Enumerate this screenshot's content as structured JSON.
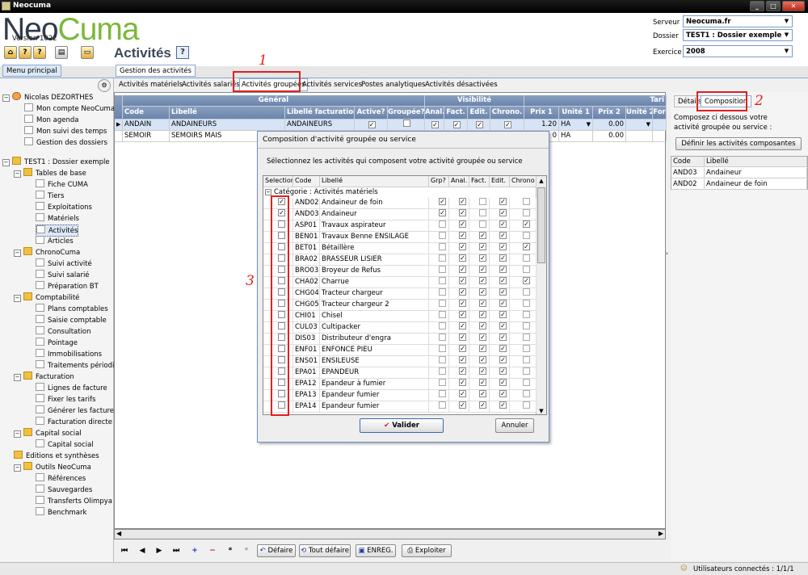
{
  "window": {
    "title": "Neocuma"
  },
  "logo": {
    "part1": "Neo",
    "part2": "Cuma",
    "version": "Version 1022"
  },
  "page": {
    "title": "Activités"
  },
  "server": {
    "server_label": "Serveur",
    "server_value": "Neocuma.fr",
    "dossier_label": "Dossier",
    "dossier_value": "TEST1 : Dossier exemple",
    "exercice_label": "Exercice",
    "exercice_value": "2008"
  },
  "tabs": {
    "menu_principal": "Menu principal",
    "gestion": "Gestion des activités"
  },
  "subtabs": [
    "Activités matériels",
    "Activités salariés",
    "Activités groupées",
    "Activités services",
    "Postes analytiques",
    "Activités désactivées"
  ],
  "tree": {
    "user": "Nicolas DEZORTHES",
    "user_items": [
      "Mon compte NeoCuma",
      "Mon agenda",
      "Mon suivi des temps",
      "Gestion des dossiers"
    ],
    "dossier": "TEST1 : Dossier exemple",
    "groups": [
      {
        "label": "Tables de base",
        "items": [
          "Fiche CUMA",
          "Tiers",
          "Exploitations",
          "Matériels",
          "Activités",
          "Articles"
        ]
      },
      {
        "label": "ChronoCuma",
        "items": [
          "Suivi activité",
          "Suivi salarié",
          "Préparation BT"
        ]
      },
      {
        "label": "Comptabilité",
        "items": [
          "Plans comptables",
          "Saisie comptable",
          "Consultation",
          "Pointage",
          "Immobilisations",
          "Traitements périodiqu"
        ]
      },
      {
        "label": "Facturation",
        "items": [
          "Lignes de facture",
          "Fixer les tarifs",
          "Générer les factures",
          "Facturation directe"
        ]
      },
      {
        "label": "Capital social",
        "items": [
          "Capital social"
        ]
      },
      {
        "label": "Editions et synthèses",
        "items": []
      },
      {
        "label": "Outils NeoCuma",
        "items": [
          "Références",
          "Sauvegardes",
          "Transferts Olimpya",
          "Benchmark"
        ]
      }
    ]
  },
  "grid": {
    "group_headers": [
      "Général",
      "Visibilité",
      "Tari"
    ],
    "columns": [
      "Code",
      "Libellé",
      "Libellé facturation",
      "Active?",
      "Groupée?",
      "Anal.",
      "Fact.",
      "Edit.",
      "Chrono.",
      "Prix 1",
      "Unité 1",
      "Prix 2",
      "Unité 2",
      "For"
    ],
    "rows": [
      {
        "code": "ANDAIN",
        "libelle": "ANDAINEURS",
        "libfact": "ANDAINEURS",
        "active": true,
        "groupee": false,
        "anal": true,
        "fact": true,
        "edit": true,
        "chrono": true,
        "prix1": "1.20",
        "unite1": "HA",
        "prix2": "0.00"
      },
      {
        "code": "SEMOIR",
        "libelle": "SEMOIRS MAIS",
        "libfact": "",
        "prix1": "0",
        "unite1": "HA",
        "prix2": "0.00"
      }
    ]
  },
  "right": {
    "tab_detail": "Détails",
    "tab_composition": "Composition",
    "text": "Composez ci dessous votre activité groupée ou service :",
    "button": "Définir les activités composantes",
    "col_code": "Code",
    "col_libelle": "Libellé",
    "rows": [
      {
        "code": "AND03",
        "libelle": "Andaineur"
      },
      {
        "code": "AND02",
        "libelle": "Andaineur de foin"
      }
    ]
  },
  "dialog": {
    "title": "Composition d'activité groupée ou service",
    "instruction": "Sélectionnez les activités qui composent votre activité groupée ou service",
    "columns": [
      "Selection",
      "Code",
      "Libellé",
      "Grp?",
      "Anal.",
      "Fact.",
      "Edit.",
      "Chrono"
    ],
    "category": "Catégorie : Activités matériels",
    "rows": [
      {
        "sel": true,
        "code": "AND02",
        "lib": "Andaineur de foin",
        "grp": true,
        "anal": true,
        "fact": false,
        "edit": true,
        "chrono": false
      },
      {
        "sel": true,
        "code": "AND03",
        "lib": "Andaineur",
        "grp": true,
        "anal": true,
        "fact": false,
        "edit": true,
        "chrono": false
      },
      {
        "sel": false,
        "code": "ASP01",
        "lib": "Travaux  aspirateur",
        "grp": false,
        "anal": true,
        "fact": false,
        "edit": true,
        "chrono": true
      },
      {
        "sel": false,
        "code": "BEN01",
        "lib": "Travaux Benne ENSILAGE",
        "grp": false,
        "anal": true,
        "fact": true,
        "edit": true,
        "chrono": false
      },
      {
        "sel": false,
        "code": "BET01",
        "lib": "Bétaillère",
        "grp": false,
        "anal": true,
        "fact": true,
        "edit": true,
        "chrono": true
      },
      {
        "sel": false,
        "code": "BRA02",
        "lib": "BRASSEUR LISIER",
        "grp": false,
        "anal": true,
        "fact": true,
        "edit": true,
        "chrono": false
      },
      {
        "sel": false,
        "code": "BRO03",
        "lib": "Broyeur de Refus",
        "grp": false,
        "anal": true,
        "fact": true,
        "edit": true,
        "chrono": false
      },
      {
        "sel": false,
        "code": "CHA02",
        "lib": "Charrue",
        "grp": false,
        "anal": true,
        "fact": true,
        "edit": true,
        "chrono": true
      },
      {
        "sel": false,
        "code": "CHG04",
        "lib": "Tracteur chargeur",
        "grp": false,
        "anal": true,
        "fact": true,
        "edit": true,
        "chrono": false
      },
      {
        "sel": false,
        "code": "CHG05",
        "lib": "Tracteur chargeur 2",
        "grp": false,
        "anal": true,
        "fact": true,
        "edit": true,
        "chrono": false
      },
      {
        "sel": false,
        "code": "CHI01",
        "lib": " Chisel",
        "grp": false,
        "anal": true,
        "fact": true,
        "edit": true,
        "chrono": false
      },
      {
        "sel": false,
        "code": "CUL03",
        "lib": " Cultipacker",
        "grp": false,
        "anal": true,
        "fact": true,
        "edit": true,
        "chrono": false
      },
      {
        "sel": false,
        "code": "DIS03",
        "lib": "Distributeur d'engra",
        "grp": false,
        "anal": true,
        "fact": true,
        "edit": true,
        "chrono": false
      },
      {
        "sel": false,
        "code": "ENF01",
        "lib": "ENFONCE PIEU",
        "grp": false,
        "anal": true,
        "fact": true,
        "edit": true,
        "chrono": false
      },
      {
        "sel": false,
        "code": "ENS01",
        "lib": "ENSILEUSE",
        "grp": false,
        "anal": true,
        "fact": true,
        "edit": true,
        "chrono": false
      },
      {
        "sel": false,
        "code": "EPA01",
        "lib": "EPANDEUR",
        "grp": false,
        "anal": true,
        "fact": true,
        "edit": true,
        "chrono": false
      },
      {
        "sel": false,
        "code": "EPA12",
        "lib": "Epandeur à fumier",
        "grp": false,
        "anal": true,
        "fact": true,
        "edit": true,
        "chrono": false
      },
      {
        "sel": false,
        "code": "EPA13",
        "lib": "Epandeur fumier",
        "grp": false,
        "anal": true,
        "fact": true,
        "edit": true,
        "chrono": false
      },
      {
        "sel": false,
        "code": "EPA14",
        "lib": "Epandeur fumier",
        "grp": false,
        "anal": true,
        "fact": true,
        "edit": true,
        "chrono": false
      }
    ],
    "valider": "Valider",
    "annuler": "Annuler"
  },
  "toolbar": {
    "defaire": "Défaire",
    "tout_defaire": "Tout défaire",
    "enreg": "ENREG.",
    "exploiter": "Exploiter"
  },
  "annotations": [
    "1",
    "2",
    "3"
  ],
  "status": {
    "users": "Utilisateurs connectés : 1/1/1"
  }
}
